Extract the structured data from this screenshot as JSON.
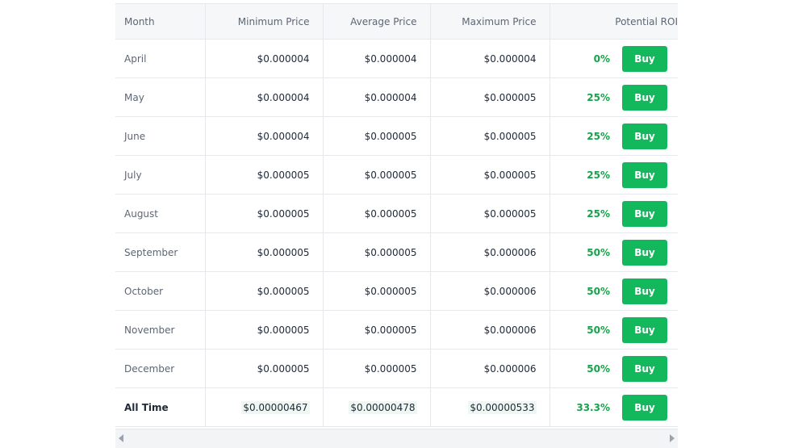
{
  "table": {
    "headers": {
      "month": "Month",
      "min": "Minimum Price",
      "avg": "Average Price",
      "max": "Maximum Price",
      "roi": "Potential ROI"
    },
    "buy_label": "Buy",
    "rows": [
      {
        "month": "April",
        "min": "$0.000004",
        "avg": "$0.000004",
        "max": "$0.000004",
        "roi": "0%"
      },
      {
        "month": "May",
        "min": "$0.000004",
        "avg": "$0.000004",
        "max": "$0.000005",
        "roi": "25%"
      },
      {
        "month": "June",
        "min": "$0.000004",
        "avg": "$0.000005",
        "max": "$0.000005",
        "roi": "25%"
      },
      {
        "month": "July",
        "min": "$0.000005",
        "avg": "$0.000005",
        "max": "$0.000005",
        "roi": "25%"
      },
      {
        "month": "August",
        "min": "$0.000005",
        "avg": "$0.000005",
        "max": "$0.000005",
        "roi": "25%"
      },
      {
        "month": "September",
        "min": "$0.000005",
        "avg": "$0.000005",
        "max": "$0.000006",
        "roi": "50%"
      },
      {
        "month": "October",
        "min": "$0.000005",
        "avg": "$0.000005",
        "max": "$0.000006",
        "roi": "50%"
      },
      {
        "month": "November",
        "min": "$0.000005",
        "avg": "$0.000005",
        "max": "$0.000006",
        "roi": "50%"
      },
      {
        "month": "December",
        "min": "$0.000005",
        "avg": "$0.000005",
        "max": "$0.000006",
        "roi": "50%"
      }
    ],
    "all_time": {
      "month": "All Time",
      "min": "$0.00000467",
      "avg": "$0.00000478",
      "max": "$0.00000533",
      "roi": "33.3%"
    }
  },
  "colors": {
    "buy_button": "#12b85b",
    "roi_text": "#16a34a",
    "header_bg": "#f6f7f9",
    "border": "#e6e8eb"
  },
  "icons": {
    "scroll_left": "triangle-left",
    "scroll_right": "triangle-right"
  }
}
